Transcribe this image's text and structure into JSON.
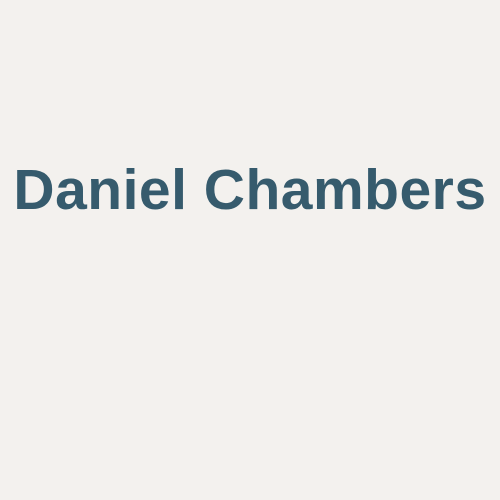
{
  "title": {
    "text": "Daniel Chambers"
  },
  "colors": {
    "background": "#f3f1ee",
    "text": "#365b6d"
  }
}
